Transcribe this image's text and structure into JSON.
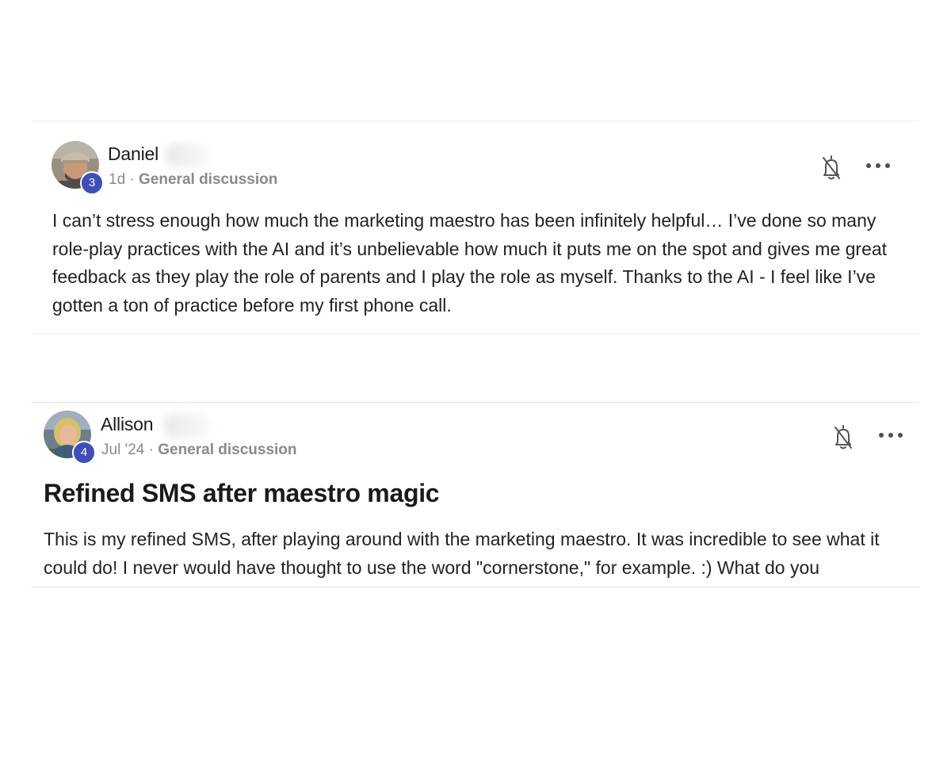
{
  "posts": [
    {
      "author": {
        "name": "Daniel",
        "level": "3",
        "avatar": "user-avatar-man-cap"
      },
      "meta": {
        "time": "1d",
        "separator": "·",
        "category": "General discussion"
      },
      "actions": {
        "notify_icon": "bell-off-icon",
        "more_icon": "more-horizontal-icon"
      },
      "body": "I can’t stress enough how much the marketing maestro has been infinitely helpful… I’ve done so many role-play practices with the AI and it’s unbelievable how much it puts me on the spot and gives me great feedback as they play the role of parents and I play the role as myself. Thanks to the AI - I feel like I’ve gotten a ton of practice before my first phone call."
    },
    {
      "author": {
        "name": "Allison",
        "level": "4",
        "avatar": "user-avatar-woman"
      },
      "meta": {
        "time": "Jul '24",
        "separator": "·",
        "category": "General discussion"
      },
      "actions": {
        "notify_icon": "bell-off-icon",
        "more_icon": "more-horizontal-icon"
      },
      "title": "Refined SMS after maestro magic",
      "body": "This is my refined SMS, after playing around with the marketing maestro. It was incredible to see what it could do! I never would have thought to use the word \"cornerstone,\" for example. :) What do you"
    }
  ],
  "colors": {
    "badge": "#3d4fb8",
    "meta_text": "#8a8a8a",
    "body_text": "#222222",
    "divider": "#e2e2e2"
  }
}
